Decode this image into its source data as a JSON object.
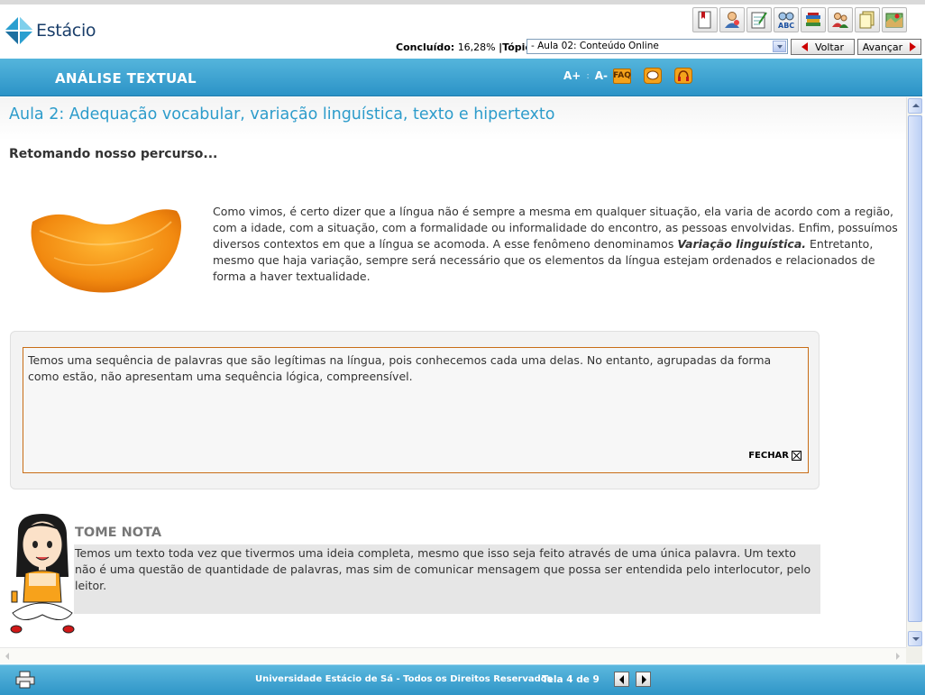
{
  "brand": {
    "name": "Estácio"
  },
  "header": {
    "toolbar_icons": [
      "bookmark-icon",
      "tutor-icon",
      "notepad-icon",
      "dictionary-icon",
      "library-icon",
      "users-icon",
      "documents-icon",
      "map-icon"
    ],
    "progress_label": "Concluído:",
    "progress_value": "16,28%",
    "progress_fraction": 0.1628,
    "topic_label": "|Tópico",
    "topic_selected": "- Aula 02: Conteúdo Online",
    "back_label": "Voltar",
    "next_label": "Avançar"
  },
  "course_bar": {
    "title": "ANÁLISE TEXTUAL",
    "font_increase": "A+",
    "font_separator": ":",
    "font_decrease": "A-",
    "faq": "FAQ"
  },
  "content": {
    "lesson_title": "Aula 2: Adequação vocabular, variação linguística, texto e hipertexto",
    "section_heading": "Retomando nosso percurso...",
    "intro_before": "Como vimos, é certo dizer que a língua não é sempre a mesma em qualquer situação, ela varia de acordo com a região, com a idade, com a situação, com a formalidade ou informalidade do encontro, as pessoas envolvidas. Enfim, possuímos diversos contextos em que a língua se acomoda. A esse fenômeno denominamos ",
    "intro_emphasis": "Variação linguística.",
    "intro_after": " Entretanto, mesmo que haja variação, sempre será necessário que os elementos da língua estejam ordenados e relacionados de forma a haver textualidade.",
    "note_text": "Temos uma sequência de palavras que são legítimas na língua, pois conhecemos cada uma delas. No entanto, agrupadas da forma como estão, não apresentam uma sequência lógica, compreensível.",
    "close_label": "FECHAR",
    "tip_heading": "TOME NOTA",
    "tip_text": "Temos um texto toda vez que tivermos uma ideia completa, mesmo que isso seja feito através de uma única palavra. Um texto não é uma questão de quantidade de palavras, mas sim de comunicar mensagem que possa ser entendida pelo interlocutor, pelo leitor."
  },
  "footer": {
    "copyright": "Universidade Estácio de Sá - Todos os Direitos Reservados",
    "page_counter": "Tela 4 de 9"
  },
  "colors": {
    "accent_blue": "#2d9ccb",
    "bar_blue": "#2b93c7",
    "note_border": "#c86d16",
    "icon_orange": "#f4a21b"
  }
}
